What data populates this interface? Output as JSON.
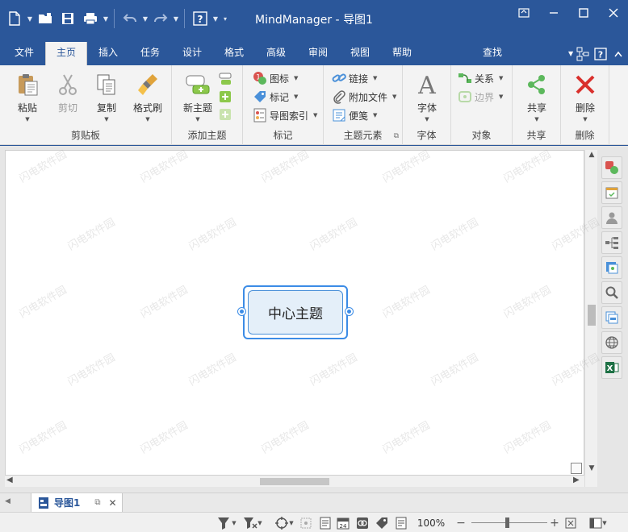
{
  "window": {
    "title": "MindManager - 导图1"
  },
  "tabs": [
    {
      "label": "文件",
      "active": false
    },
    {
      "label": "主页",
      "active": true
    },
    {
      "label": "插入",
      "active": false
    },
    {
      "label": "任务",
      "active": false
    },
    {
      "label": "设计",
      "active": false
    },
    {
      "label": "格式",
      "active": false
    },
    {
      "label": "高级",
      "active": false
    },
    {
      "label": "审阅",
      "active": false
    },
    {
      "label": "视图",
      "active": false
    },
    {
      "label": "帮助",
      "active": false
    },
    {
      "label": "查找",
      "active": false
    }
  ],
  "ribbon": {
    "clipboard": {
      "label": "剪贴板",
      "paste": "粘贴",
      "cut": "剪切",
      "copy": "复制",
      "format_painter": "格式刷"
    },
    "add_topic": {
      "label": "添加主题",
      "new_topic": "新主题"
    },
    "markers": {
      "label": "标记",
      "icons": "图标",
      "tags": "标记",
      "map_index": "导图索引"
    },
    "topic_elements": {
      "label": "主题元素",
      "link": "链接",
      "attachment": "附加文件",
      "notes": "便笺"
    },
    "font": {
      "label": "字体",
      "font": "字体"
    },
    "objects": {
      "label": "对象",
      "relationship": "关系",
      "boundary": "边界"
    },
    "share": {
      "label": "共享",
      "share": "共享"
    },
    "delete": {
      "label": "删除",
      "delete": "删除"
    }
  },
  "canvas": {
    "central_topic": "中心主题"
  },
  "watermark": "闪电软件园",
  "doc_tabs": [
    {
      "name": "导图1",
      "active": true
    }
  ],
  "statusbar": {
    "zoom": "100%",
    "calendar_day": "24"
  },
  "colors": {
    "titlebar": "#2b579a",
    "ribbon": "#f3f3f3",
    "topic_border": "#3c8ce6",
    "topic_fill": "#e4eff9"
  }
}
